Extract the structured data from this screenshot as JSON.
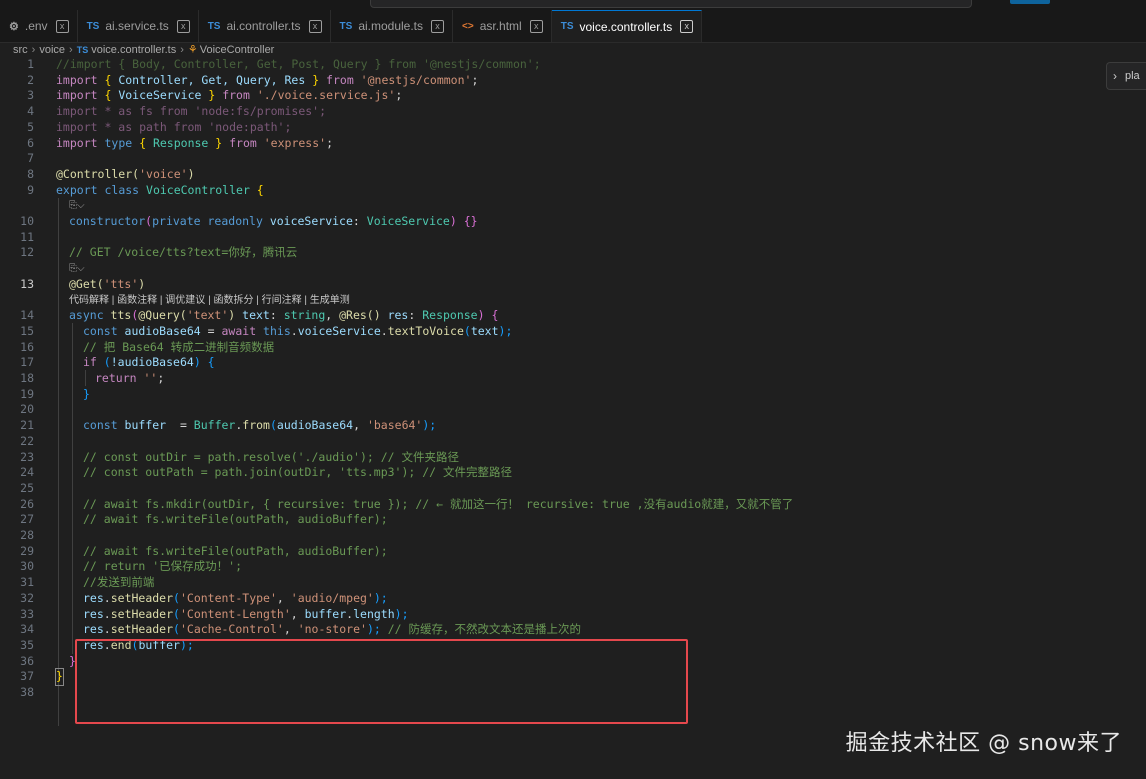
{
  "tabs": [
    {
      "icon": "gear-icon",
      "label": ".env",
      "active": false
    },
    {
      "icon": "ts",
      "label": "ai.service.ts",
      "active": false
    },
    {
      "icon": "ts",
      "label": "ai.controller.ts",
      "active": false
    },
    {
      "icon": "ts",
      "label": "ai.module.ts",
      "active": false
    },
    {
      "icon": "html",
      "label": "asr.html",
      "active": false
    },
    {
      "icon": "ts",
      "label": "voice.controller.ts",
      "active": true
    }
  ],
  "tab_icons": {
    "ts": "TS",
    "html": "<>",
    "close": "x"
  },
  "breadcrumb": {
    "src": "src",
    "voice": "voice",
    "file": "voice.controller.ts",
    "symbol": "VoiceController",
    "ts_badge": "TS"
  },
  "side_button": {
    "label": "pla"
  },
  "code_lens": "代码解释 | 函数注释 | 调优建议 | 函数拆分 | 行间注释 | 生成单测",
  "lines": [
    {
      "n": "1",
      "y": 0
    },
    {
      "n": "2",
      "y": 1
    },
    {
      "n": "3",
      "y": 2
    },
    {
      "n": "4",
      "y": 3
    },
    {
      "n": "5",
      "y": 4
    },
    {
      "n": "6",
      "y": 5
    },
    {
      "n": "7",
      "y": 6
    },
    {
      "n": "8",
      "y": 7
    },
    {
      "n": "9",
      "y": 8
    },
    {
      "n": "10",
      "y": 10
    },
    {
      "n": "11",
      "y": 11
    },
    {
      "n": "12",
      "y": 12
    },
    {
      "n": "13",
      "y": 14
    },
    {
      "n": "14",
      "y": 16
    },
    {
      "n": "15",
      "y": 17
    },
    {
      "n": "16",
      "y": 18
    },
    {
      "n": "17",
      "y": 19
    },
    {
      "n": "18",
      "y": 20
    },
    {
      "n": "19",
      "y": 21
    },
    {
      "n": "20",
      "y": 22
    },
    {
      "n": "21",
      "y": 23
    },
    {
      "n": "22",
      "y": 24
    },
    {
      "n": "23",
      "y": 25
    },
    {
      "n": "24",
      "y": 26
    },
    {
      "n": "25",
      "y": 27
    },
    {
      "n": "26",
      "y": 28
    },
    {
      "n": "27",
      "y": 29
    },
    {
      "n": "28",
      "y": 30
    },
    {
      "n": "29",
      "y": 31
    },
    {
      "n": "30",
      "y": 32
    },
    {
      "n": "31",
      "y": 33
    },
    {
      "n": "32",
      "y": 34
    },
    {
      "n": "33",
      "y": 35
    },
    {
      "n": "34",
      "y": 36
    },
    {
      "n": "35",
      "y": 37
    },
    {
      "n": "36",
      "y": 38
    },
    {
      "n": "37",
      "y": 39
    },
    {
      "n": "38",
      "y": 40
    }
  ],
  "code": {
    "l1": "//import { Body, Controller, Get, Post, Query } from '@nestjs/common';",
    "l2a": "import",
    "l2b": " { ",
    "l2c": "Controller, Get, Query, Res",
    "l2d": " } ",
    "l2e": "from",
    "l2f": " '@nestjs/common'",
    "l2g": ";",
    "l3a": "import",
    "l3b": " { ",
    "l3c": "VoiceService",
    "l3d": " } ",
    "l3e": "from",
    "l3f": " './voice.service.js'",
    "l3g": ";",
    "l4": "import * as fs from 'node:fs/promises';",
    "l5": "import * as path from 'node:path';",
    "l6a": "import",
    "l6b": " type",
    "l6c": " { ",
    "l6d": "Response",
    "l6e": " } ",
    "l6f": "from",
    "l6g": " 'express'",
    "l6h": ";",
    "l8a": "@Controller(",
    "l8b": "'voice'",
    "l8c": ")",
    "l9a": "export",
    "l9b": " class",
    "l9c": " VoiceController",
    "l9d": " {",
    "l10a": "constructor",
    "l10b": "(",
    "l10c": "private",
    "l10d": " readonly",
    "l10e": " voiceService",
    "l10f": ": ",
    "l10g": "VoiceService",
    "l10h": ") ",
    "l10i": "{}",
    "l12": "// GET /voice/tts?text=你好，腾讯云",
    "l13a": "@Get(",
    "l13b": "'tts'",
    "l13c": ")",
    "l14a": "async",
    "l14b": " tts",
    "l14c": "(",
    "l14d": "@Query(",
    "l14e": "'text'",
    "l14f": ")",
    "l14g": " text",
    "l14h": ": ",
    "l14i": "string",
    "l14j": ", ",
    "l14k": "@Res()",
    "l14l": " res",
    "l14m": ": ",
    "l14n": "Response",
    "l14o": ") {",
    "l15a": "const",
    "l15b": " audioBase64",
    "l15c": " = ",
    "l15d": "await",
    "l15e": " this",
    "l15f": ".",
    "l15g": "voiceService",
    "l15h": ".",
    "l15i": "textToVoice",
    "l15j": "(",
    "l15k": "text",
    "l15l": ");",
    "l16": "// 把 Base64 转成二进制音频数据",
    "l17a": "if",
    "l17b": " (",
    "l17c": "!audioBase64",
    "l17d": ") {",
    "l18a": "return",
    "l18b": " ''",
    "l18c": ";",
    "l19": "}",
    "l21a": "const",
    "l21b": " buffer",
    "l21c": "  = ",
    "l21d": "Buffer",
    "l21e": ".",
    "l21f": "from",
    "l21g": "(",
    "l21h": "audioBase64",
    "l21i": ", ",
    "l21j": "'base64'",
    "l21k": ");",
    "l23": "// const outDir = path.resolve('./audio'); // 文件夹路径",
    "l24": "// const outPath = path.join(outDir, 'tts.mp3'); // 文件完整路径",
    "l26": "// await fs.mkdir(outDir, { recursive: true }); // ← 就加这一行！ recursive: true ,没有audio就建，又就不管了",
    "l27": "// await fs.writeFile(outPath, audioBuffer);",
    "l29": "// await fs.writeFile(outPath, audioBuffer);",
    "l30": "// return '已保存成功！';",
    "l31": "//发送到前端",
    "l32a": "res",
    "l32b": ".",
    "l32c": "setHeader",
    "l32d": "(",
    "l32e": "'Content-Type'",
    "l32f": ", ",
    "l32g": "'audio/mpeg'",
    "l32h": ");",
    "l33a": "res",
    "l33b": ".",
    "l33c": "setHeader",
    "l33d": "(",
    "l33e": "'Content-Length'",
    "l33f": ", ",
    "l33g": "buffer",
    "l33h": ".",
    "l33i": "length",
    "l33j": ");",
    "l34a": "res",
    "l34b": ".",
    "l34c": "setHeader",
    "l34d": "(",
    "l34e": "'Cache-Control'",
    "l34f": ", ",
    "l34g": "'no-store'",
    "l34h": "); ",
    "l34i": "// 防缓存，不然改文本还是播上次的",
    "l35a": "res",
    "l35b": ".",
    "l35c": "end",
    "l35d": "(",
    "l35e": "buffer",
    "l35f": ");",
    "l36": "}",
    "l37": "}"
  },
  "lens_icon": "⎘⌵",
  "watermark": "掘金技术社区 @ snow来了"
}
